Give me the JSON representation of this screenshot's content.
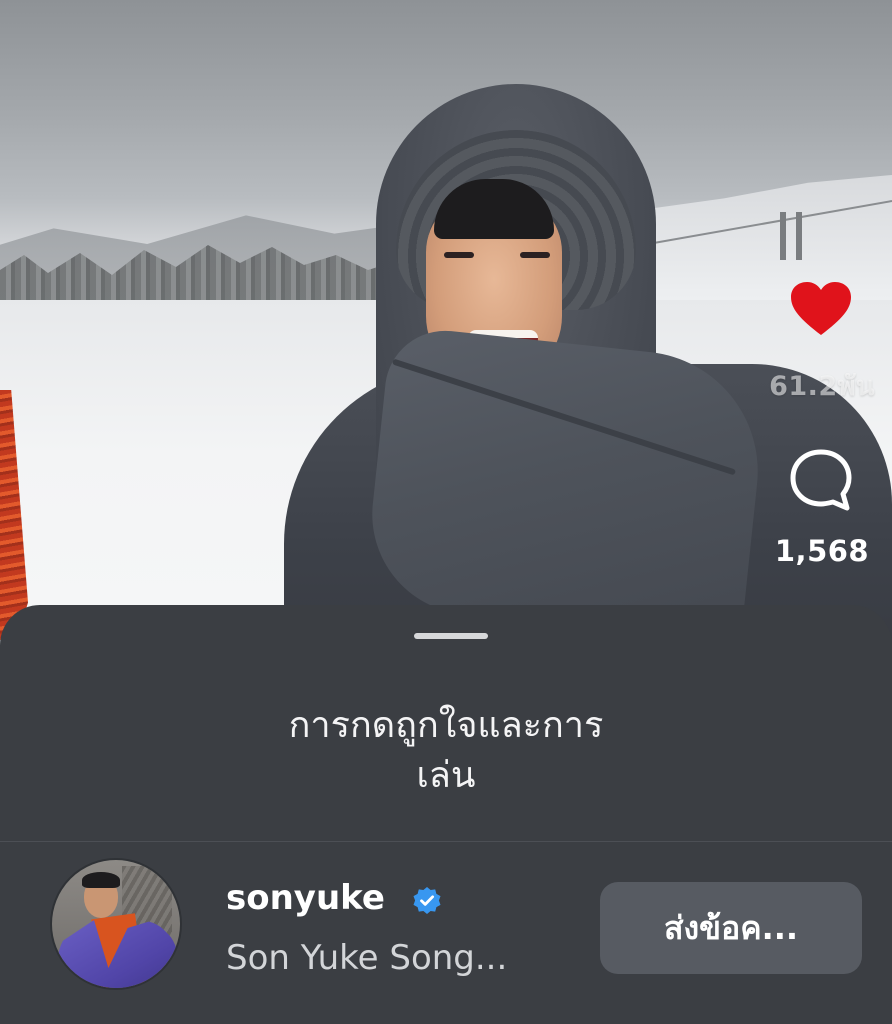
{
  "reel": {
    "like_count": "61.2พัน",
    "comment_count": "1,568",
    "like_icon": "heart-icon",
    "comment_icon": "comment-bubble-icon",
    "like_color": "#e0131b"
  },
  "sheet": {
    "title_line1": "การกดถูกใจและการ",
    "title_line2": "เล่น",
    "user": {
      "username": "sonyuke",
      "full_name": "Son Yuke Song...",
      "verified": true,
      "verified_icon": "verified-badge-icon",
      "verified_color": "#3897f0",
      "message_button_label": "ส่งข้อค..."
    }
  }
}
